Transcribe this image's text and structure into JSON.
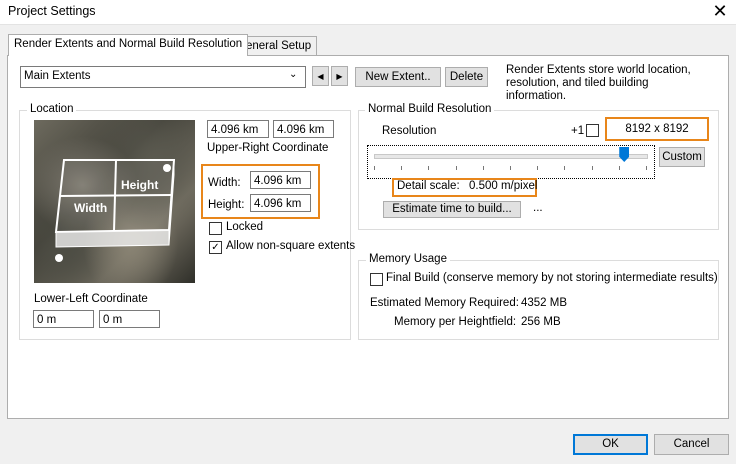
{
  "window": {
    "title": "Project Settings",
    "close_icon": "close-icon"
  },
  "tabs": [
    {
      "label": "Render Extents and Normal Build Resolution",
      "active": true
    },
    {
      "label": "General Setup",
      "active": false
    }
  ],
  "extents": {
    "selected": "Main Extents",
    "new_label": "New Extent..",
    "delete_label": "Delete",
    "description": "Render Extents store world location, resolution, and tiled building information."
  },
  "location": {
    "group_label": "Location",
    "upper_right": [
      "4.096 km",
      "4.096 km"
    ],
    "upper_right_label": "Upper-Right Coordinate",
    "width_label": "Width:",
    "width_value": "4.096 km",
    "height_label": "Height:",
    "height_value": "4.096 km",
    "locked_label": "Locked",
    "locked": false,
    "nonsquare_label": "Allow non-square extents",
    "nonsquare": true,
    "lower_left_label": "Lower-Left Coordinate",
    "lower_left": [
      "0 m",
      "0 m"
    ],
    "diagram_width": "Width",
    "diagram_height": "Height"
  },
  "resolution": {
    "group_label": "Normal Build Resolution",
    "label": "Resolution",
    "plus_one_label": "+1",
    "plus_one": false,
    "value": "8192 x 8192",
    "custom_label": "Custom",
    "slider_fraction": 0.92,
    "detail_label": "Detail scale:",
    "detail_value": "0.500 m/pixel",
    "estimate_label": "Estimate time to build...",
    "estimate_result": "..."
  },
  "memory": {
    "group_label": "Memory Usage",
    "final_build_label": "Final Build (conserve memory by not storing intermediate results)",
    "final_build": false,
    "estimated_label": "Estimated Memory Required:",
    "estimated_value": "4352 MB",
    "per_label": "Memory per Heightfield:",
    "per_value": "256 MB"
  },
  "footer": {
    "ok_label": "OK",
    "cancel_label": "Cancel"
  },
  "colors": {
    "highlight": "#e8861a",
    "accent": "#0078d7"
  }
}
